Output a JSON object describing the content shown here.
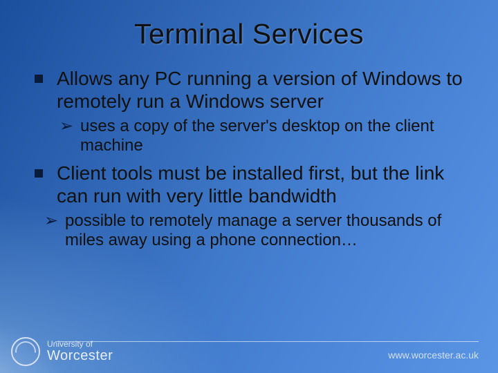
{
  "title": "Terminal Services",
  "bullets": [
    {
      "level": 1,
      "text": "Allows any PC running a version of Windows to remotely run a Windows server"
    },
    {
      "level": 2,
      "text": "uses a copy of the server's desktop on the client machine"
    },
    {
      "level": 1,
      "text": "Client tools must be installed first, but the link can run with very little bandwidth"
    },
    {
      "level": "2b",
      "text": "possible to remotely manage a server thousands of miles away using a phone connection…"
    }
  ],
  "footer": {
    "institution_prefix": "University of",
    "institution_name": "Worcester",
    "url": "www.worcester.ac.uk"
  }
}
